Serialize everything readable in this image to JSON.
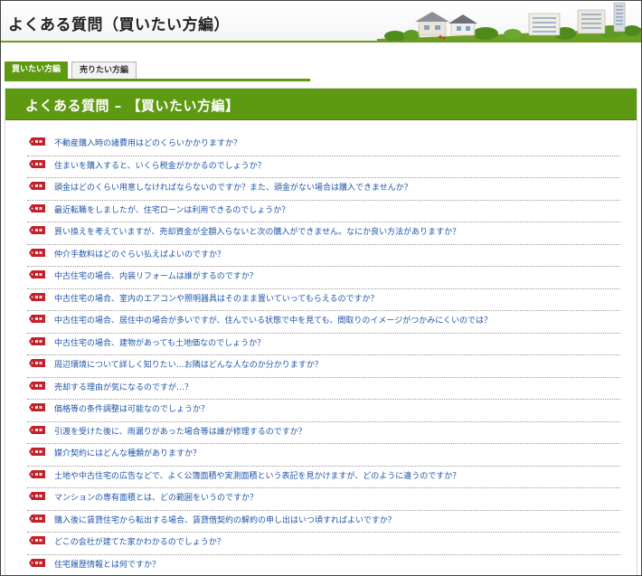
{
  "header": {
    "title": "よくある質問（買いたい方編）"
  },
  "tabs": [
    {
      "label": "買いたい方編",
      "active": true
    },
    {
      "label": "売りたい方編",
      "active": false
    }
  ],
  "section": {
    "title": "よくある質問 – 【買いたい方編】"
  },
  "colors": {
    "accent_green": "#5e9a11",
    "link_blue": "#1f56a8",
    "badge_red": "#c4222a"
  },
  "badge_icon": "question-tag-icon",
  "faq": [
    "不動産購入時の諸費用はどのくらいかかりますか？",
    "住まいを購入すると、いくら税金がかかるのでしょうか？",
    "頭金はどのくらい用意しなければならないのですか？また、頭金がない場合は購入できませんか？",
    "最近転職をしましたが、住宅ローンは利用できるのでしょうか？",
    "買い換えを考えていますが、売却資金が全額入らないと次の購入ができません。なにか良い方法がありますか？",
    "仲介手数料はどのぐらい払えばよいのですか？",
    "中古住宅の場合、内装リフォームは誰がするのですか？",
    "中古住宅の場合、室内のエアコンや照明器具はそのまま置いていってもらえるのですか？",
    "中古住宅の場合、居住中の場合が多いですが、住んでいる状態で中を見ても、間取りのイメージがつかみにくいのでは？",
    "中古住宅の場合、建物があっても土地価なのでしょうか？",
    "周辺環境について詳しく知りたい…お隣はどんな人なのか分かりますか？",
    "売却する理由が気になるのですが…？",
    "価格等の条件調整は可能なのでしょうか？",
    "引渡を受けた後に、雨漏りがあった場合等は誰が修理するのですか？",
    "媒介契約にはどんな種類がありますか？",
    "土地や中古住宅の広告などで、よく公簿面積や実測面積という表記を見かけますが、どのように違うのですか？",
    "マンションの専有面積とは、どの範囲をいうのですか？",
    "購入後に賃貸住宅から転出する場合、賃貸借契約の解約の申し出はいつ頃すればよいですか？",
    "どこの会社が建てた家かわかるのでしょうか？",
    "住宅履歴情報とは何ですか？"
  ]
}
